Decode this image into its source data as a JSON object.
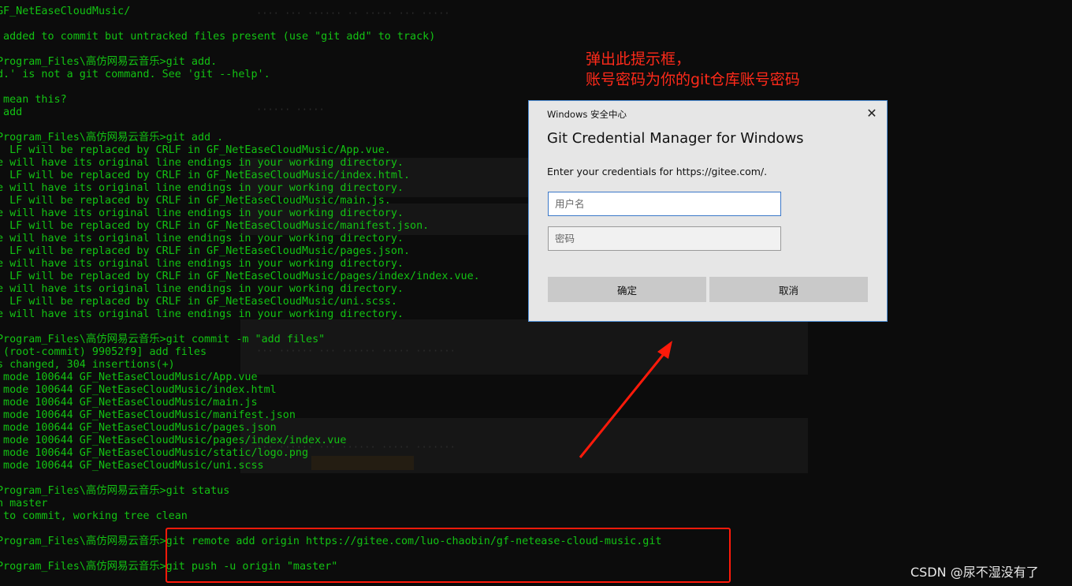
{
  "terminal": {
    "text_color": "#13c313",
    "background": "#0c0c0c",
    "lines": [
      "GF_NetEaseCloudMusic/",
      "",
      " added to commit but untracked files present (use \"git add\" to track)",
      "",
      "Program_Files\\高仿网易云音乐>git add.",
      "d.' is not a git command. See 'git --help'.",
      "",
      " mean this?",
      " add",
      "",
      "Program_Files\\高仿网易云音乐>git add .",
      "  LF will be replaced by CRLF in GF_NetEaseCloudMusic/App.vue.",
      "e will have its original line endings in your working directory.",
      "  LF will be replaced by CRLF in GF_NetEaseCloudMusic/index.html.",
      "e will have its original line endings in your working directory.",
      "  LF will be replaced by CRLF in GF_NetEaseCloudMusic/main.js.",
      "e will have its original line endings in your working directory.",
      "  LF will be replaced by CRLF in GF_NetEaseCloudMusic/manifest.json.",
      "e will have its original line endings in your working directory.",
      "  LF will be replaced by CRLF in GF_NetEaseCloudMusic/pages.json.",
      "e will have its original line endings in your working directory.",
      "  LF will be replaced by CRLF in GF_NetEaseCloudMusic/pages/index/index.vue.",
      "e will have its original line endings in your working directory.",
      "  LF will be replaced by CRLF in GF_NetEaseCloudMusic/uni.scss.",
      "e will have its original line endings in your working directory.",
      "",
      "Program_Files\\高仿网易云音乐>git commit -m \"add files\"",
      " (root-commit) 99052f9] add files",
      "s changed, 304 insertions(+)",
      " mode 100644 GF_NetEaseCloudMusic/App.vue",
      " mode 100644 GF_NetEaseCloudMusic/index.html",
      " mode 100644 GF_NetEaseCloudMusic/main.js",
      " mode 100644 GF_NetEaseCloudMusic/manifest.json",
      " mode 100644 GF_NetEaseCloudMusic/pages.json",
      " mode 100644 GF_NetEaseCloudMusic/pages/index/index.vue",
      " mode 100644 GF_NetEaseCloudMusic/static/logo.png",
      " mode 100644 GF_NetEaseCloudMusic/uni.scss",
      "",
      "Program_Files\\高仿网易云音乐>git status",
      "h master",
      " to commit, working tree clean",
      "",
      "Program_Files\\高仿网易云音乐>git remote add origin https://gitee.com/luo-chaobin/gf-netease-cloud-music.git",
      "",
      "Program_Files\\高仿网易云音乐>git push -u origin \"master\""
    ]
  },
  "annotation": {
    "line1": "弹出此提示框，",
    "line2": "账号密码为你的git仓库账号密码",
    "color": "#ff2a1a"
  },
  "dialog": {
    "caption": "Windows 安全中心",
    "close_glyph": "✕",
    "close_icon": "close-icon",
    "title": "Git Credential Manager for Windows",
    "message": "Enter your credentials for https://gitee.com/.",
    "username_placeholder": "用户名",
    "password_placeholder": "密码",
    "ok_label": "确定",
    "cancel_label": "取消",
    "accent": "#3b78c8"
  },
  "watermark": "CSDN @尿不湿没有了"
}
